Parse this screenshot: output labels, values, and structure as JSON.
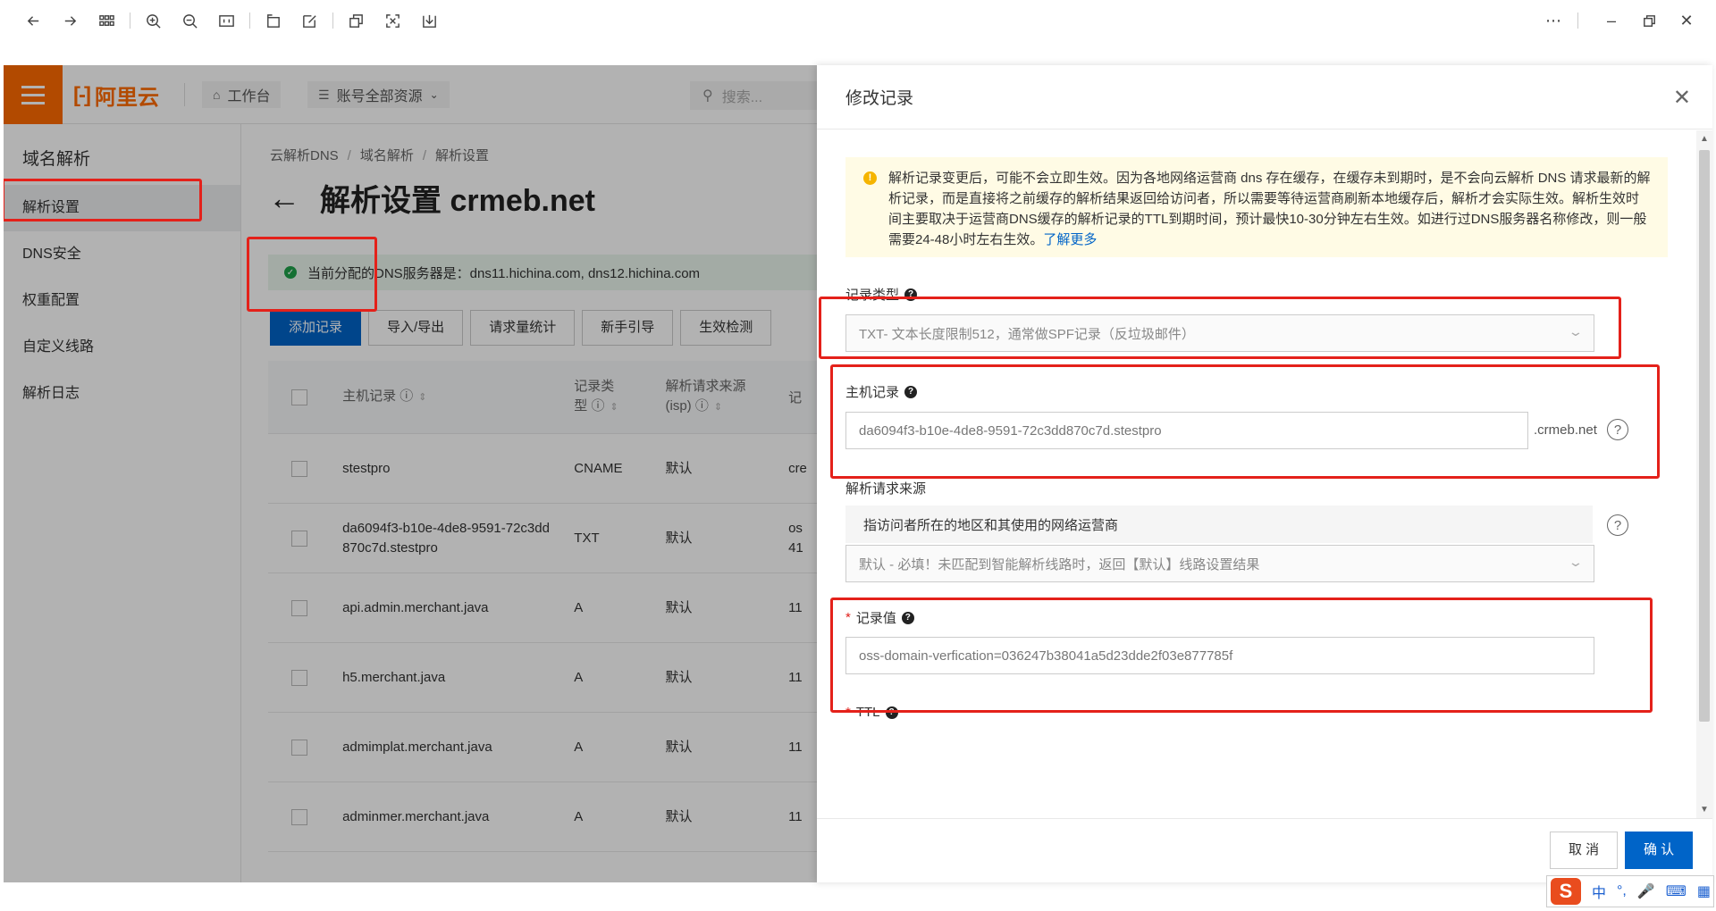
{
  "viewer": {
    "tools": [
      "back-arrow-icon",
      "forward-arrow-icon",
      "grid-icon",
      "zoom-in-icon",
      "zoom-out-icon",
      "actual-size-icon",
      "rotate-icon",
      "edit-icon",
      "copy-icon",
      "fullscreen-icon",
      "download-icon"
    ],
    "window_controls": [
      "more-icon",
      "minimize-icon",
      "restore-icon",
      "close-icon"
    ]
  },
  "topnav": {
    "logo_text": "阿里云",
    "workbench": "工作台",
    "resources": "账号全部资源",
    "search_placeholder": "搜索..."
  },
  "leftnav": {
    "title": "域名解析",
    "items": [
      {
        "label": "解析设置",
        "active": true
      },
      {
        "label": "DNS安全",
        "active": false
      },
      {
        "label": "权重配置",
        "active": false
      },
      {
        "label": "自定义线路",
        "active": false
      },
      {
        "label": "解析日志",
        "active": false
      }
    ]
  },
  "breadcrumb": [
    "云解析DNS",
    "域名解析",
    "解析设置"
  ],
  "page_title": "解析设置 crmeb.net",
  "dns_notice": "当前分配的DNS服务器是：dns11.hichina.com, dns12.hichina.com",
  "actions": [
    "添加记录",
    "导入/导出",
    "请求量统计",
    "新手引导",
    "生效检测"
  ],
  "table": {
    "headers": {
      "host": "主机记录",
      "type_line1": "记录类",
      "type_line2": "型",
      "source_line1": "解析请求来源",
      "source_line2": "(isp)",
      "value": "记"
    },
    "rows": [
      {
        "host_line1": "stestpro",
        "host_line2": "",
        "type": "CNAME",
        "source": "默认",
        "value": "cre"
      },
      {
        "host_line1": "da6094f3-b10e-4de8-9591-72c3dd",
        "host_line2": "870c7d.stestpro",
        "type": "TXT",
        "source": "默认",
        "value": "os"
      },
      {
        "host_line1": "api.admin.merchant.java",
        "host_line2": "",
        "type": "A",
        "source": "默认",
        "value": "11"
      },
      {
        "host_line1": "h5.merchant.java",
        "host_line2": "",
        "type": "A",
        "source": "默认",
        "value": "11"
      },
      {
        "host_line1": "admimplat.merchant.java",
        "host_line2": "",
        "type": "A",
        "source": "默认",
        "value": "11"
      },
      {
        "host_line1": "adminmer.merchant.java",
        "host_line2": "",
        "type": "A",
        "source": "默认",
        "value": "11"
      }
    ],
    "row2_value_line2": "41"
  },
  "drawer": {
    "title": "修改记录",
    "warning_text": "解析记录变更后，可能不会立即生效。因为各地网络运营商 dns 存在缓存，在缓存未到期时，是不会向云解析 DNS 请求最新的解析记录，而是直接将之前缓存的解析结果返回给访问者，所以需要等待运营商刷新本地缓存后，解析才会实际生效。解析生效时间主要取决于运营商DNS缓存的解析记录的TTL到期时间，预计最快10-30分钟左右生效。如进行过DNS服务器名称修改，则一般需要24-48小时左右生效。",
    "warning_link": "了解更多",
    "record_type_label": "记录类型",
    "record_type_value": "TXT- 文本长度限制512，通常做SPF记录（反垃圾邮件）",
    "host_label": "主机记录",
    "host_value": "da6094f3-b10e-4de8-9591-72c3dd870c7d.stestpro",
    "host_suffix": ".crmeb.net",
    "source_label": "解析请求来源",
    "source_desc": "指访问者所在的地区和其使用的网络运营商",
    "source_value": "默认 - 必填！未匹配到智能解析线路时，返回【默认】线路设置结果",
    "value_label": "记录值",
    "value_value": "oss-domain-verfication=036247b38041a5d23dde2f03e877785f",
    "ttl_label": "TTL",
    "cancel": "取 消",
    "confirm": "确 认"
  },
  "ime": {
    "lang": "中",
    "punct": "°,"
  },
  "colors": {
    "brand": "#ff6a00",
    "primary": "#0064c8",
    "highlight": "#e4211a",
    "warning_bg": "#fffbe5"
  }
}
